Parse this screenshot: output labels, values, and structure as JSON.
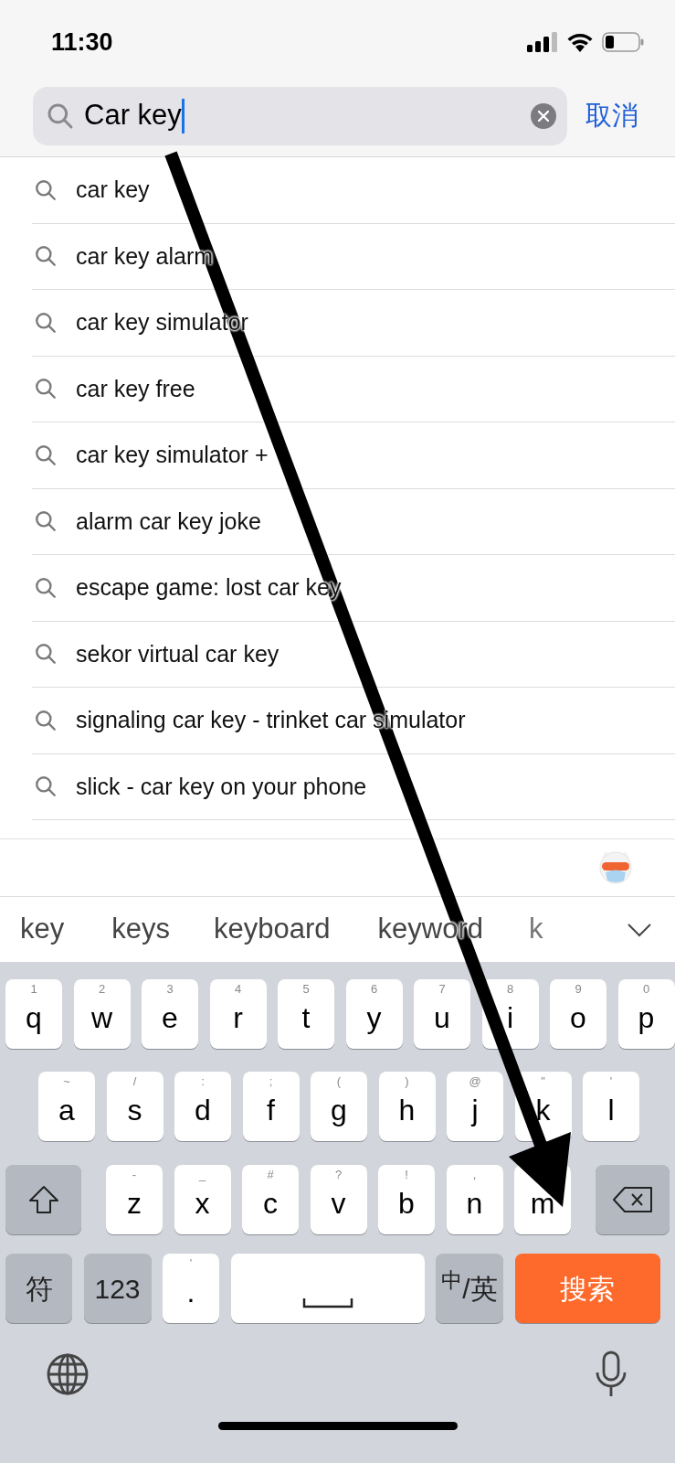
{
  "status_bar": {
    "time": "11:30"
  },
  "search": {
    "value": "Car key",
    "cancel": "取消"
  },
  "suggestions": [
    "car key",
    "car key alarm",
    "car key simulator",
    "car key free",
    "car key simulator +",
    "alarm car key joke",
    "escape game: lost car key",
    "sekor virtual car key",
    "signaling car key - trinket car simulator",
    "slick - car key on your phone"
  ],
  "candidates": [
    {
      "text": "key",
      "faded": false
    },
    {
      "text": "keys",
      "faded": false
    },
    {
      "text": "keyboard",
      "faded": false
    },
    {
      "text": "keyword",
      "faded": false
    },
    {
      "text": "k",
      "faded": true
    }
  ],
  "keyboard": {
    "rows": [
      {
        "keys": [
          {
            "kind": "letter",
            "label": "q",
            "hint": "1"
          },
          {
            "kind": "letter",
            "label": "w",
            "hint": "2"
          },
          {
            "kind": "letter",
            "label": "e",
            "hint": "3"
          },
          {
            "kind": "letter",
            "label": "r",
            "hint": "4"
          },
          {
            "kind": "letter",
            "label": "t",
            "hint": "5"
          },
          {
            "kind": "letter",
            "label": "y",
            "hint": "6"
          },
          {
            "kind": "letter",
            "label": "u",
            "hint": "7"
          },
          {
            "kind": "letter",
            "label": "i",
            "hint": "8"
          },
          {
            "kind": "letter",
            "label": "o",
            "hint": "9"
          },
          {
            "kind": "letter",
            "label": "p",
            "hint": "0"
          }
        ]
      },
      {
        "keys": [
          {
            "kind": "letter",
            "label": "a",
            "hint": "~"
          },
          {
            "kind": "letter",
            "label": "s",
            "hint": "/"
          },
          {
            "kind": "letter",
            "label": "d",
            "hint": ":"
          },
          {
            "kind": "letter",
            "label": "f",
            "hint": ";"
          },
          {
            "kind": "letter",
            "label": "g",
            "hint": "("
          },
          {
            "kind": "letter",
            "label": "h",
            "hint": ")"
          },
          {
            "kind": "letter",
            "label": "j",
            "hint": "@"
          },
          {
            "kind": "letter",
            "label": "k",
            "hint": "\""
          },
          {
            "kind": "letter",
            "label": "l",
            "hint": "'"
          }
        ]
      },
      {
        "keys": [
          {
            "kind": "shift"
          },
          {
            "kind": "letter",
            "label": "z",
            "hint": "-"
          },
          {
            "kind": "letter",
            "label": "x",
            "hint": "_"
          },
          {
            "kind": "letter",
            "label": "c",
            "hint": "#"
          },
          {
            "kind": "letter",
            "label": "v",
            "hint": "?"
          },
          {
            "kind": "letter",
            "label": "b",
            "hint": "!"
          },
          {
            "kind": "letter",
            "label": "n",
            "hint": ","
          },
          {
            "kind": "letter",
            "label": "m"
          },
          {
            "kind": "delete"
          }
        ]
      },
      {
        "keys": [
          {
            "kind": "function",
            "label": "符"
          },
          {
            "kind": "function",
            "label": "123"
          },
          {
            "kind": "letter",
            "label": ".",
            "hint": "'"
          },
          {
            "kind": "space"
          },
          {
            "kind": "function",
            "label": "$^{中}$/英"
          },
          {
            "kind": "action",
            "label": "搜索"
          }
        ]
      }
    ]
  }
}
